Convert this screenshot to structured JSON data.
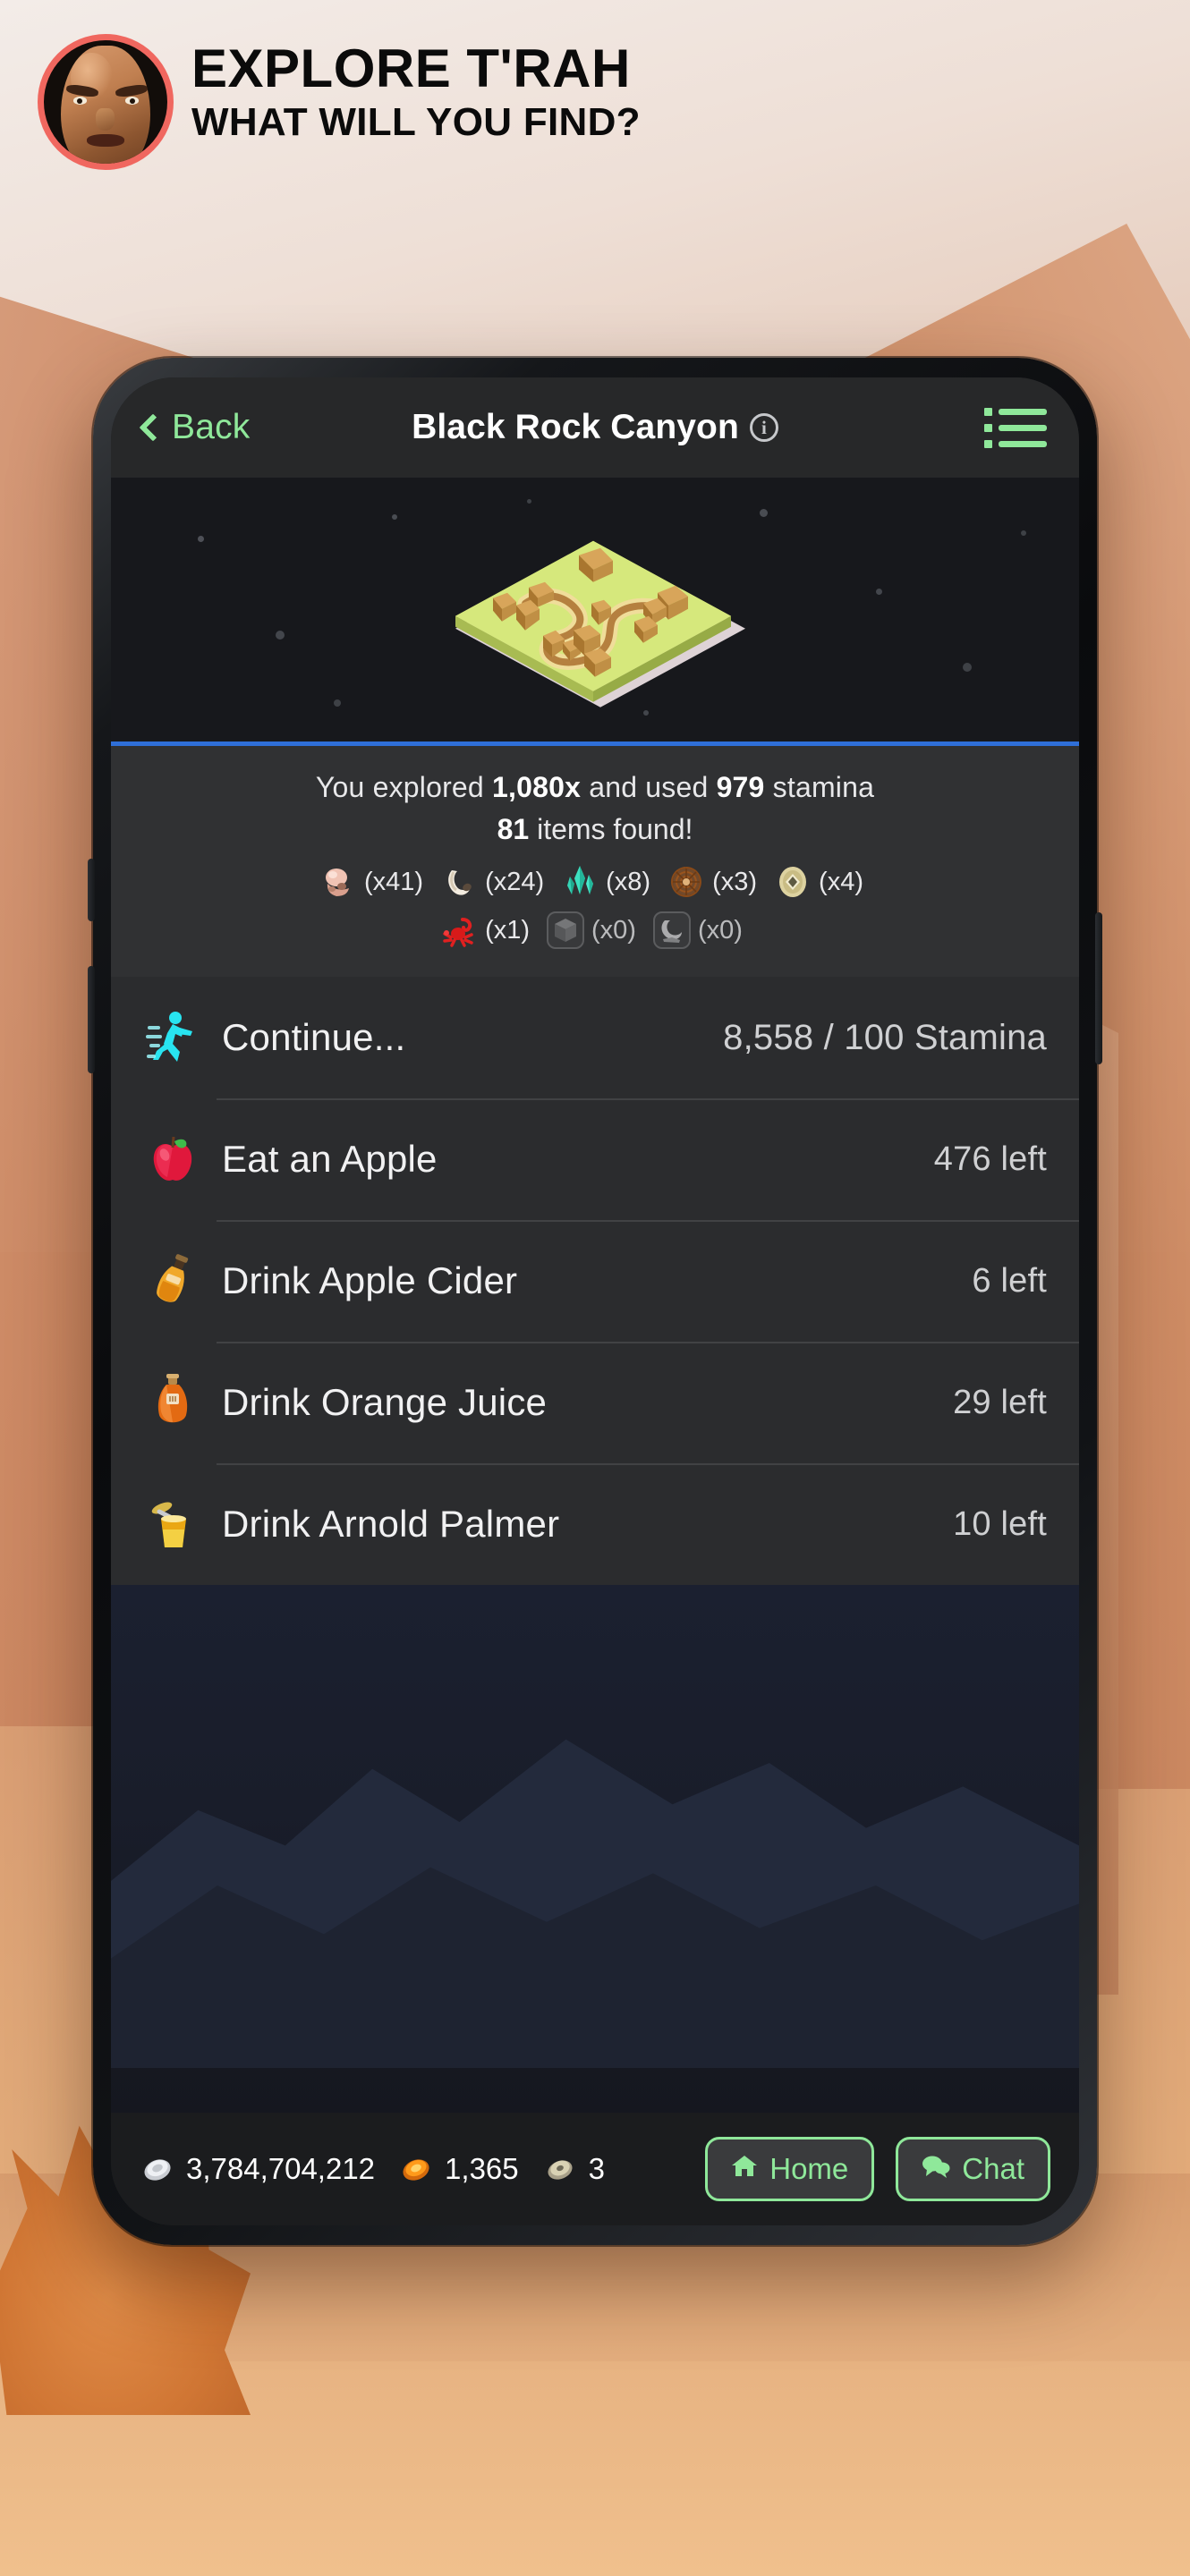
{
  "banner": {
    "title_main": "EXPLORE T'RAH",
    "title_sub": "WHAT WILL YOU FIND?",
    "avatar_icon": "warrior-face-avatar",
    "ring_color": "#f0675f"
  },
  "navbar": {
    "back_label": "Back",
    "back_icon": "chevron-left-icon",
    "title": "Black Rock Canyon",
    "info_icon": "info-icon",
    "info_glyph": "i",
    "menu_icon": "list-menu-icon",
    "accent_color": "#8fe89a"
  },
  "hero": {
    "map_icon": "isometric-canyon-map-tile",
    "divider_color": "#2f6fd8"
  },
  "summary": {
    "line1_prefix": "You explored ",
    "explored_count": "1,080x",
    "line1_middle": " and used ",
    "stamina_used": "979",
    "line1_suffix": " stamina",
    "items_found_count": "81",
    "items_found_suffix": " items found!",
    "found_items": [
      {
        "icon": "bone-skull-icon",
        "count": "(x41)",
        "dim": false
      },
      {
        "icon": "tusk-shell-icon",
        "count": "(x24)",
        "dim": false
      },
      {
        "icon": "teal-crystal-icon",
        "count": "(x8)",
        "dim": false
      },
      {
        "icon": "ammonite-fossil-icon",
        "count": "(x3)",
        "dim": false
      },
      {
        "icon": "gold-coin-relic-icon",
        "count": "(x4)",
        "dim": false
      },
      {
        "icon": "red-scorpion-icon",
        "count": "(x1)",
        "dim": false
      },
      {
        "icon": "stone-cube-icon",
        "count": "(x0)",
        "dim": true
      },
      {
        "icon": "gray-fossil-icon",
        "count": "(x0)",
        "dim": true
      }
    ]
  },
  "actions": [
    {
      "icon": "running-figure-icon",
      "label": "Continue...",
      "value": "8,558  / 100 Stamina"
    },
    {
      "icon": "red-apple-icon",
      "label": "Eat an Apple",
      "value": "476 left"
    },
    {
      "icon": "cider-bottle-icon",
      "label": "Drink Apple Cider",
      "value": "6 left"
    },
    {
      "icon": "orange-juice-flask-icon",
      "label": "Drink Orange Juice",
      "value": "29 left"
    },
    {
      "icon": "arnold-palmer-glass-icon",
      "label": "Drink Arnold Palmer",
      "value": "10 left"
    }
  ],
  "bottombar": {
    "currencies": [
      {
        "icon": "silver-coin-icon",
        "value": "3,784,704,212"
      },
      {
        "icon": "gold-coin-icon",
        "value": "1,365"
      },
      {
        "icon": "bronze-coin-icon",
        "value": "3"
      }
    ],
    "home_button": {
      "label": "Home",
      "icon": "home-icon"
    },
    "chat_button": {
      "label": "Chat",
      "icon": "chat-bubbles-icon"
    }
  }
}
